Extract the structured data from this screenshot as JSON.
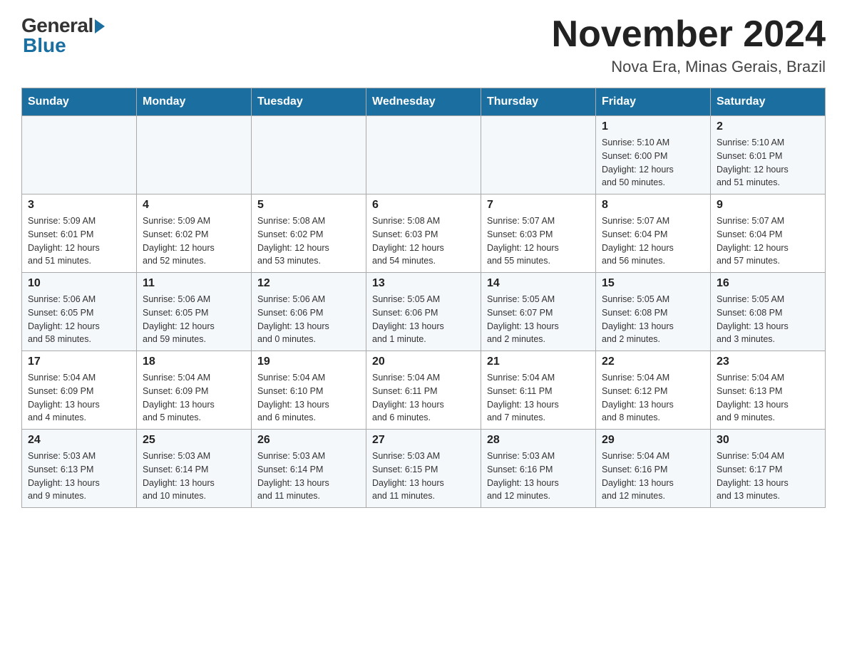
{
  "header": {
    "logo_general": "General",
    "logo_blue": "Blue",
    "title": "November 2024",
    "subtitle": "Nova Era, Minas Gerais, Brazil"
  },
  "weekdays": [
    "Sunday",
    "Monday",
    "Tuesday",
    "Wednesday",
    "Thursday",
    "Friday",
    "Saturday"
  ],
  "weeks": [
    [
      {
        "day": "",
        "info": ""
      },
      {
        "day": "",
        "info": ""
      },
      {
        "day": "",
        "info": ""
      },
      {
        "day": "",
        "info": ""
      },
      {
        "day": "",
        "info": ""
      },
      {
        "day": "1",
        "info": "Sunrise: 5:10 AM\nSunset: 6:00 PM\nDaylight: 12 hours\nand 50 minutes."
      },
      {
        "day": "2",
        "info": "Sunrise: 5:10 AM\nSunset: 6:01 PM\nDaylight: 12 hours\nand 51 minutes."
      }
    ],
    [
      {
        "day": "3",
        "info": "Sunrise: 5:09 AM\nSunset: 6:01 PM\nDaylight: 12 hours\nand 51 minutes."
      },
      {
        "day": "4",
        "info": "Sunrise: 5:09 AM\nSunset: 6:02 PM\nDaylight: 12 hours\nand 52 minutes."
      },
      {
        "day": "5",
        "info": "Sunrise: 5:08 AM\nSunset: 6:02 PM\nDaylight: 12 hours\nand 53 minutes."
      },
      {
        "day": "6",
        "info": "Sunrise: 5:08 AM\nSunset: 6:03 PM\nDaylight: 12 hours\nand 54 minutes."
      },
      {
        "day": "7",
        "info": "Sunrise: 5:07 AM\nSunset: 6:03 PM\nDaylight: 12 hours\nand 55 minutes."
      },
      {
        "day": "8",
        "info": "Sunrise: 5:07 AM\nSunset: 6:04 PM\nDaylight: 12 hours\nand 56 minutes."
      },
      {
        "day": "9",
        "info": "Sunrise: 5:07 AM\nSunset: 6:04 PM\nDaylight: 12 hours\nand 57 minutes."
      }
    ],
    [
      {
        "day": "10",
        "info": "Sunrise: 5:06 AM\nSunset: 6:05 PM\nDaylight: 12 hours\nand 58 minutes."
      },
      {
        "day": "11",
        "info": "Sunrise: 5:06 AM\nSunset: 6:05 PM\nDaylight: 12 hours\nand 59 minutes."
      },
      {
        "day": "12",
        "info": "Sunrise: 5:06 AM\nSunset: 6:06 PM\nDaylight: 13 hours\nand 0 minutes."
      },
      {
        "day": "13",
        "info": "Sunrise: 5:05 AM\nSunset: 6:06 PM\nDaylight: 13 hours\nand 1 minute."
      },
      {
        "day": "14",
        "info": "Sunrise: 5:05 AM\nSunset: 6:07 PM\nDaylight: 13 hours\nand 2 minutes."
      },
      {
        "day": "15",
        "info": "Sunrise: 5:05 AM\nSunset: 6:08 PM\nDaylight: 13 hours\nand 2 minutes."
      },
      {
        "day": "16",
        "info": "Sunrise: 5:05 AM\nSunset: 6:08 PM\nDaylight: 13 hours\nand 3 minutes."
      }
    ],
    [
      {
        "day": "17",
        "info": "Sunrise: 5:04 AM\nSunset: 6:09 PM\nDaylight: 13 hours\nand 4 minutes."
      },
      {
        "day": "18",
        "info": "Sunrise: 5:04 AM\nSunset: 6:09 PM\nDaylight: 13 hours\nand 5 minutes."
      },
      {
        "day": "19",
        "info": "Sunrise: 5:04 AM\nSunset: 6:10 PM\nDaylight: 13 hours\nand 6 minutes."
      },
      {
        "day": "20",
        "info": "Sunrise: 5:04 AM\nSunset: 6:11 PM\nDaylight: 13 hours\nand 6 minutes."
      },
      {
        "day": "21",
        "info": "Sunrise: 5:04 AM\nSunset: 6:11 PM\nDaylight: 13 hours\nand 7 minutes."
      },
      {
        "day": "22",
        "info": "Sunrise: 5:04 AM\nSunset: 6:12 PM\nDaylight: 13 hours\nand 8 minutes."
      },
      {
        "day": "23",
        "info": "Sunrise: 5:04 AM\nSunset: 6:13 PM\nDaylight: 13 hours\nand 9 minutes."
      }
    ],
    [
      {
        "day": "24",
        "info": "Sunrise: 5:03 AM\nSunset: 6:13 PM\nDaylight: 13 hours\nand 9 minutes."
      },
      {
        "day": "25",
        "info": "Sunrise: 5:03 AM\nSunset: 6:14 PM\nDaylight: 13 hours\nand 10 minutes."
      },
      {
        "day": "26",
        "info": "Sunrise: 5:03 AM\nSunset: 6:14 PM\nDaylight: 13 hours\nand 11 minutes."
      },
      {
        "day": "27",
        "info": "Sunrise: 5:03 AM\nSunset: 6:15 PM\nDaylight: 13 hours\nand 11 minutes."
      },
      {
        "day": "28",
        "info": "Sunrise: 5:03 AM\nSunset: 6:16 PM\nDaylight: 13 hours\nand 12 minutes."
      },
      {
        "day": "29",
        "info": "Sunrise: 5:04 AM\nSunset: 6:16 PM\nDaylight: 13 hours\nand 12 minutes."
      },
      {
        "day": "30",
        "info": "Sunrise: 5:04 AM\nSunset: 6:17 PM\nDaylight: 13 hours\nand 13 minutes."
      }
    ]
  ]
}
